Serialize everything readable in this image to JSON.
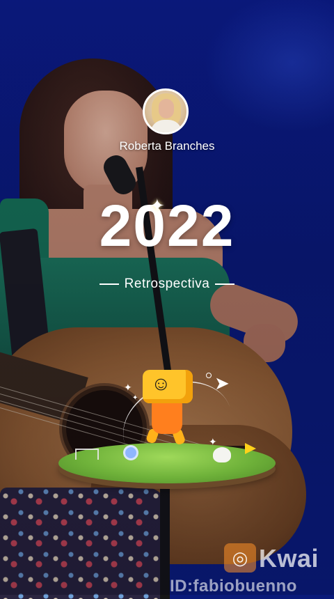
{
  "profile": {
    "name": "Roberta Branches"
  },
  "recap": {
    "year": "2022",
    "subtitle": "Retrospectiva"
  },
  "watermark": {
    "brand": "Kwai",
    "id": "ID:fabiobuenno"
  },
  "icons": {
    "year_sparkle": "sparkle-icon",
    "paper_plane": "paper-plane-icon",
    "logo": "kwai-logo-icon"
  },
  "colors": {
    "background": "#0a1a7a",
    "text": "#ffffff",
    "mascot": "#ffc42a",
    "brand": "#ff9128"
  }
}
